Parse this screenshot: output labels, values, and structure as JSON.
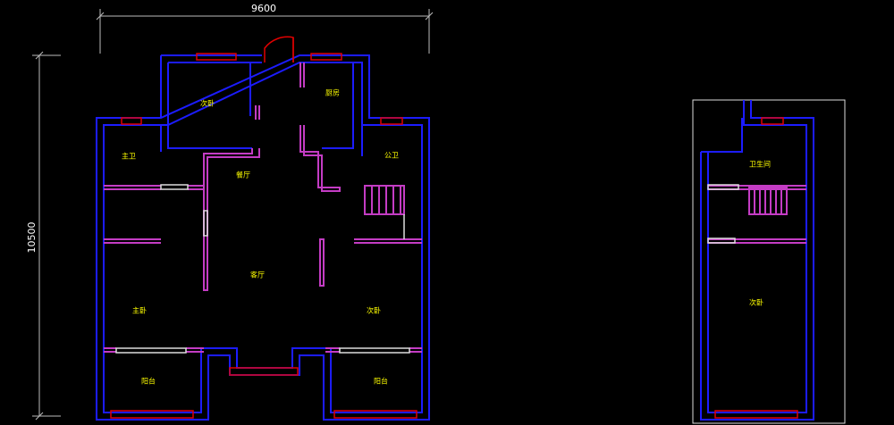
{
  "dimensions": {
    "width_label": "9600",
    "height_label": "10500"
  },
  "rooms": {
    "secondary_bedroom_top": "次卧",
    "kitchen": "厨房",
    "master_bath": "主卫",
    "public_bath": "公卫",
    "dining": "餐厅",
    "living": "客厅",
    "master_bedroom": "主卧",
    "secondary_bedroom_right": "次卧",
    "balcony_left": "阳台",
    "balcony_right": "阳台",
    "upper_bathroom": "卫生间",
    "upper_bedroom": "次卧"
  },
  "colors": {
    "background": "#000000",
    "wall": "#1c1cff",
    "partition": "#c43cc4",
    "window": "#e00000",
    "label": "#ffff00",
    "dimension": "#bbbbbb"
  }
}
